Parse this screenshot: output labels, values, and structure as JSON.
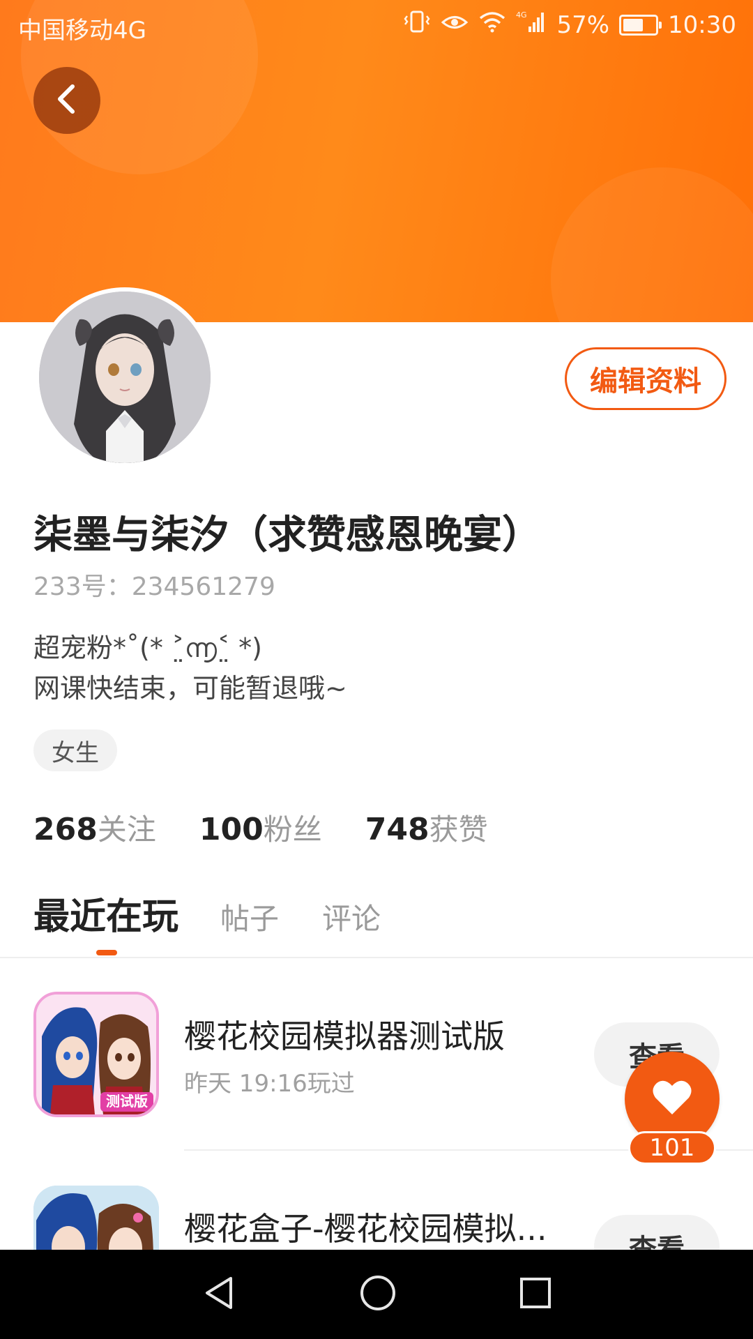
{
  "status_bar": {
    "carrier": "中国移动4G",
    "network": "4G",
    "battery": "57%",
    "time": "10:30"
  },
  "profile": {
    "name": "柒墨与柒汐（求赞感恩晚宴）",
    "uid": "233号：234561279",
    "bio_line1": "超宠粉*˚(* ˃̤൬˂̤ *)",
    "bio_line2": "网课快结束，可能暂退哦~",
    "gender_tag": "女生",
    "edit_label": "编辑资料"
  },
  "stats": [
    {
      "count": "268",
      "label": "关注"
    },
    {
      "count": "100",
      "label": "粉丝"
    },
    {
      "count": "748",
      "label": "获赞"
    }
  ],
  "tabs": [
    {
      "label": "最近在玩",
      "active": true
    },
    {
      "label": "帖子",
      "active": false
    },
    {
      "label": "评论",
      "active": false
    }
  ],
  "games": [
    {
      "title": "樱花校园模拟器测试版",
      "subtitle": "昨天 19:16玩过",
      "button": "查看",
      "badge": "测试版"
    },
    {
      "title": "樱花盒子-樱花校园模拟...",
      "subtitle": "",
      "button": "查看"
    }
  ],
  "like": {
    "count": "101"
  },
  "icons": {
    "back": "chevron-left-icon",
    "like": "heart-icon",
    "nav_back": "triangle-back-icon",
    "nav_home": "circle-home-icon",
    "nav_recent": "square-recent-icon"
  },
  "colors": {
    "brand": "#f25a12",
    "banner": "#ff8a1a"
  }
}
